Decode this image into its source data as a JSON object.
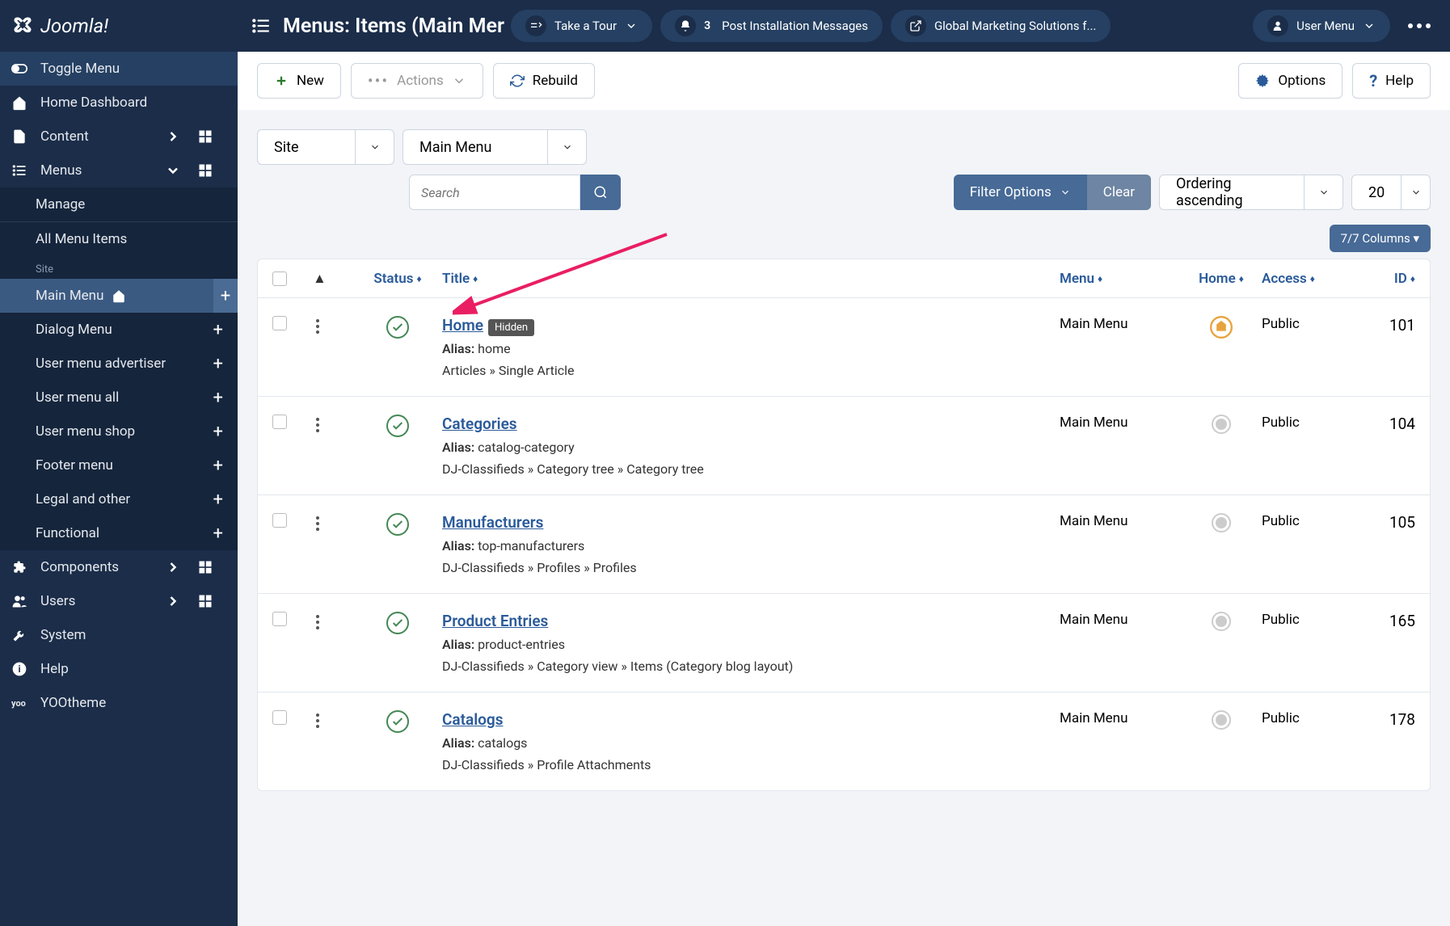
{
  "brand": "Joomla!",
  "page_title": "Menus: Items (Main Mer",
  "topbar": {
    "tour": "Take a Tour",
    "notif_count": "3",
    "notif_label": "Post Installation Messages",
    "site_link": "Global Marketing Solutions f...",
    "user_menu": "User Menu"
  },
  "sidebar": {
    "toggle": "Toggle Menu",
    "home": "Home Dashboard",
    "content": "Content",
    "menus": "Menus",
    "manage": "Manage",
    "all_items": "All Menu Items",
    "site_label": "Site",
    "main_menu": "Main Menu",
    "dialog": "Dialog Menu",
    "adv": "User menu advertiser",
    "all": "User menu all",
    "shop": "User menu shop",
    "footer": "Footer menu",
    "legal": "Legal and other",
    "functional": "Functional",
    "components": "Components",
    "users": "Users",
    "system": "System",
    "help": "Help",
    "yoo": "YOOtheme"
  },
  "actions": {
    "new": "New",
    "actions": "Actions",
    "rebuild": "Rebuild",
    "options": "Options",
    "help": "Help"
  },
  "filters": {
    "client": "Site",
    "menu": "Main Menu",
    "search_placeholder": "Search",
    "filter_options": "Filter Options",
    "clear": "Clear",
    "ordering": "Ordering ascending",
    "limit": "20",
    "columns": "7/7 Columns"
  },
  "headers": {
    "status": "Status",
    "title": "Title",
    "menu": "Menu",
    "home": "Home",
    "access": "Access",
    "id": "ID"
  },
  "rows": [
    {
      "title": "Home",
      "hidden": true,
      "alias": "home",
      "path": "Articles » Single Article",
      "menu": "Main Menu",
      "is_home": true,
      "access": "Public",
      "id": "101"
    },
    {
      "title": "Categories",
      "hidden": false,
      "alias": "catalog-category",
      "path": "DJ-Classifieds » Category tree » Category tree",
      "menu": "Main Menu",
      "is_home": false,
      "access": "Public",
      "id": "104"
    },
    {
      "title": "Manufacturers",
      "hidden": false,
      "alias": "top-manufacturers",
      "path": "DJ-Classifieds » Profiles » Profiles",
      "menu": "Main Menu",
      "is_home": false,
      "access": "Public",
      "id": "105"
    },
    {
      "title": "Product Entries",
      "hidden": false,
      "alias": "product-entries",
      "path": "DJ-Classifieds » Category view » Items (Category blog layout)",
      "menu": "Main Menu",
      "is_home": false,
      "access": "Public",
      "id": "165"
    },
    {
      "title": "Catalogs",
      "hidden": false,
      "alias": "catalogs",
      "path": "DJ-Classifieds » Profile Attachments",
      "menu": "Main Menu",
      "is_home": false,
      "access": "Public",
      "id": "178"
    }
  ],
  "labels": {
    "alias_prefix": "Alias: ",
    "hidden_badge": "Hidden"
  }
}
